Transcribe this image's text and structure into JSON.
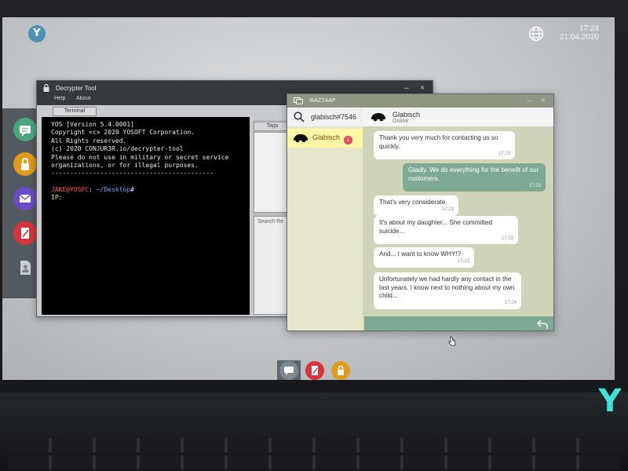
{
  "topbar": {
    "time": "17:24",
    "date": "21.04.2020",
    "logo": "Y"
  },
  "dock": {
    "icons": [
      "wazzaap-icon",
      "lock-icon",
      "mail-icon",
      "notes-icon",
      "document-icon"
    ]
  },
  "decrypter": {
    "title": "Decrypter Tool",
    "menu": [
      "Help",
      "About"
    ],
    "tab_terminal": "Terminal",
    "tab_tags": "Tags",
    "search_label": "Search Re",
    "terminal_lines": [
      "YOS [Version 5.4.0001]",
      "Copyright <c> 2020 YOSOFT Corporation.",
      "All Rights reserved.",
      "",
      "(c) 2020 CONJUR3R.io/decrypter-tool",
      "Please do not use in military or secret service",
      "organizations, or for illegal purposes.",
      "-------------------------------------------"
    ],
    "prompt_user": "JAKE@YOSPC",
    "prompt_sep": ": ",
    "prompt_path": "~/Desktop",
    "prompt_hash": "#",
    "ip_label": "IP:"
  },
  "wazzaap": {
    "title": "WAZZAAP",
    "search_text": "glabisch#7546",
    "contact_name": "Glabisch",
    "unread_count": "1",
    "header_name": "Glabisch",
    "header_status": "Online",
    "messages": [
      {
        "dir": "in",
        "text": "Thank you very much for contacting us so quickly.",
        "time": "17:23"
      },
      {
        "dir": "out",
        "text": "Gladly. We do everything for the benefit of our customers.",
        "time": "17:23"
      },
      {
        "dir": "in",
        "text": "That's very considerate.",
        "time": "17:23"
      },
      {
        "dir": "in",
        "text": "It's about my daughter... She committed suicide...",
        "time": "17:23"
      },
      {
        "dir": "in",
        "text": "And... I want to know WHY!?",
        "time": "17:23"
      },
      {
        "dir": "in",
        "text": "Unfortunately we had hardly any contact in the last years. I know next to nothing about my own child...",
        "time": "17:24"
      }
    ]
  },
  "taskbar": {
    "icons": [
      "wazzaap-icon",
      "notes-icon",
      "lock-icon"
    ]
  },
  "colors": {
    "accent_teal": "#3fe3d8",
    "bubble_out": "#7ea994",
    "badge": "#e8485a"
  }
}
